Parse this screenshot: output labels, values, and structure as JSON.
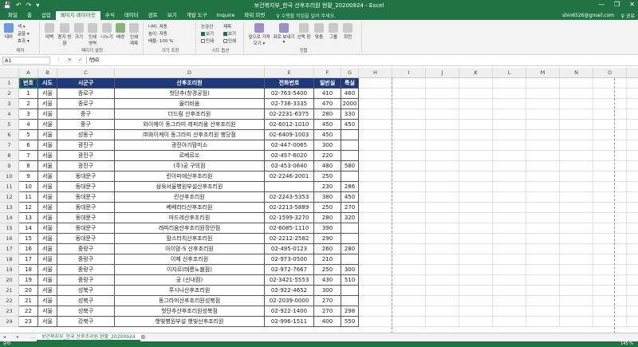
{
  "window": {
    "title": "보건복지부_한국 산후조리원 현황_20200924 - Excel",
    "qat": [
      "💾",
      "↶",
      "↷",
      "▾"
    ],
    "controls": [
      "—",
      "❐",
      "✕"
    ]
  },
  "ribbon_tabs": [
    "파일",
    "홈",
    "삽입",
    "페이지 레이아웃",
    "수식",
    "데이터",
    "검토",
    "보기",
    "개발 도구",
    "Inquire",
    "파워 피벗"
  ],
  "active_tab": "페이지 레이아웃",
  "tell_me": "♀ 수행할 작업을 알려 주세요.",
  "user": "shin6526@gmail.com",
  "share": "♀ 공유",
  "ribbon": {
    "theme_group": {
      "label": "테마",
      "buttons": [
        "테마",
        "색 ▾",
        "글꼴 ▾",
        "효과 ▾"
      ]
    },
    "page_setup_group": {
      "label": "페이지 설정",
      "buttons": [
        "여백",
        "용지 방향",
        "크기",
        "인쇄 영역",
        "나누기",
        "배경",
        "인쇄 제목"
      ]
    },
    "scale_group": {
      "label": "크기 조정",
      "rows": [
        "너비: 자동",
        "높이: 자동",
        "배율: 100 %"
      ]
    },
    "sheet_options_group": {
      "label": "시트 옵션",
      "cols": [
        "눈금선",
        "제목"
      ],
      "rows": [
        "보기",
        "인쇄"
      ]
    },
    "arrange_group": {
      "label": "정렬",
      "buttons": [
        "앞으로 가져오기 ▾",
        "뒤로 보내기 ▾",
        "선택 창",
        "맞춤",
        "그룹",
        "회전"
      ]
    }
  },
  "formula_bar": {
    "name_box": "A1",
    "fx_icons": "⋮ ✕ ✓ fx",
    "content": "번호"
  },
  "columns": [
    "A",
    "B",
    "C",
    "D",
    "E",
    "F",
    "G",
    "H",
    "I",
    "J",
    "K",
    "L",
    "M",
    "N",
    "O",
    "P"
  ],
  "table_headers": [
    "번호",
    "시도",
    "시군구",
    "산후조리원",
    "전화번호",
    "일반실",
    "특실"
  ],
  "rows": [
    [
      "1",
      "서울",
      "종로구",
      "첫단추(창경궁점)",
      "02-763-5400",
      "410",
      "460"
    ],
    [
      "2",
      "서울",
      "종로구",
      "올리비움",
      "02-738-3335",
      "470",
      "2000"
    ],
    [
      "3",
      "서울",
      "중구",
      "더드림 산후조리원",
      "02-2231-6375",
      "280",
      "330"
    ],
    [
      "4",
      "서울",
      "중구",
      "와이케이 동그라미 레피리움 산후조리원",
      "02-6012-1010",
      "450",
      "450"
    ],
    [
      "5",
      "서울",
      "성동구",
      "㈜와이케이 동그라미 산후조리원 행당점",
      "02-6409-1003",
      "450",
      ""
    ],
    [
      "6",
      "서울",
      "광진구",
      "광진아기맘미소",
      "02-447-0065",
      "300",
      ""
    ],
    [
      "7",
      "서울",
      "광진구",
      "르베르쏘",
      "02-457-6020",
      "220",
      ""
    ],
    [
      "8",
      "서울",
      "광진구",
      "(주)궁 구의점",
      "02-453-0640",
      "480",
      "580"
    ],
    [
      "9",
      "서울",
      "동대문구",
      "린아미에산후조리원",
      "02-2246-2001",
      "250",
      ""
    ],
    [
      "10",
      "서울",
      "동대문구",
      "삼육서울병원부설산후조리원",
      "",
      "230",
      "286"
    ],
    [
      "11",
      "서울",
      "동대문구",
      "린산후조리원",
      "02-2243-5353",
      "380",
      "450"
    ],
    [
      "12",
      "서울",
      "동대문구",
      "베베리타산후조리원",
      "02-2213-5889",
      "250",
      "270"
    ],
    [
      "13",
      "서울",
      "동대문구",
      "마드레산후조리원",
      "02-1599-3270",
      "280",
      "320"
    ],
    [
      "14",
      "서울",
      "동대문구",
      "레피리움산후조리원장안점",
      "02-6085-1110",
      "390",
      ""
    ],
    [
      "15",
      "서울",
      "동대문구",
      "맘스터치산후조리원",
      "02-2212-2582",
      "290",
      ""
    ],
    [
      "16",
      "서울",
      "중랑구",
      "아이맘-S 산후조리원",
      "02-495-0123",
      "260",
      "280"
    ],
    [
      "17",
      "서울",
      "중랑구",
      "이제 산후조리원",
      "02-973-0500",
      "210",
      ""
    ],
    [
      "18",
      "서울",
      "중랑구",
      "이자르(태릉노블점)",
      "02-972-7667",
      "250",
      "300"
    ],
    [
      "19",
      "서울",
      "중랑구",
      "궁 (신내점)",
      "02-3421-5553",
      "430",
      "510"
    ],
    [
      "20",
      "서울",
      "성북구",
      "루시나산후조리원",
      "02-922-4652",
      "300",
      ""
    ],
    [
      "21",
      "서울",
      "성북구",
      "동그라미산후조리원성북점",
      "02-2039-0000",
      "270",
      ""
    ],
    [
      "22",
      "서울",
      "성북구",
      "첫단추산후조리원성북점",
      "02-922-1400",
      "270",
      "298"
    ],
    [
      "23",
      "서울",
      "강북구",
      "햇빛병원부설 햇빛산후조리원",
      "02-996-1511",
      "400",
      "550"
    ]
  ],
  "sheet_tab": "보건복지부_한국 산후조리원 현황_20200924",
  "sheet_nav": "◂ ▸ …",
  "add_sheet": "⊕",
  "status": {
    "ready": "준비",
    "zoom": "145 %"
  }
}
